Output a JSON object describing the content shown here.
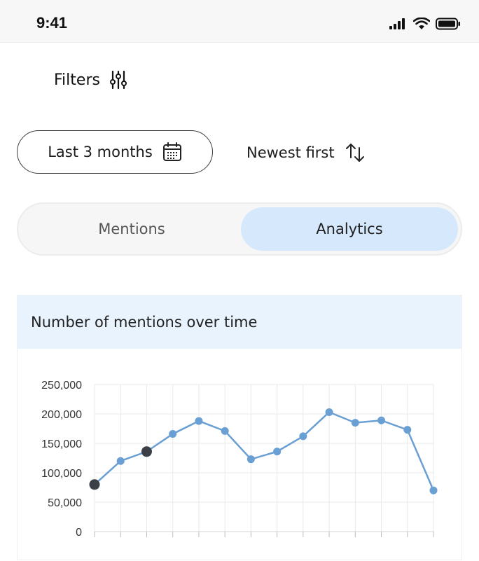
{
  "status": {
    "time": "9:41"
  },
  "filters": {
    "label": "Filters",
    "icon": "sliders-icon"
  },
  "date_range": {
    "label": "Last 3 months",
    "icon": "calendar-icon"
  },
  "sort": {
    "label": "Newest first",
    "icon": "sort-arrows-icon"
  },
  "tabs": [
    {
      "label": "Mentions",
      "active": false
    },
    {
      "label": "Analytics",
      "active": true
    }
  ],
  "card": {
    "title": "Number of mentions over time"
  },
  "colors": {
    "accent": "#6a9fd4",
    "active_tab": "#d6e8fb",
    "header_bg": "#e8f3fd",
    "highlight_point": "#3b3f46"
  },
  "chart_data": {
    "type": "line",
    "title": "Number of mentions over time",
    "xlabel": "",
    "ylabel": "",
    "ylim": [
      0,
      250000
    ],
    "yticks": [
      "0",
      "50,000",
      "100,000",
      "150,000",
      "200,000",
      "250,000"
    ],
    "x": [
      "",
      "",
      "",
      "",
      "",
      "",
      "",
      "",
      "",
      "",
      "",
      "",
      "",
      ""
    ],
    "values": [
      80000,
      120000,
      136000,
      166000,
      188000,
      171000,
      123000,
      136000,
      162000,
      203000,
      185000,
      189000,
      173000,
      70000
    ],
    "highlighted_indices": [
      0,
      2
    ],
    "grid": true
  }
}
